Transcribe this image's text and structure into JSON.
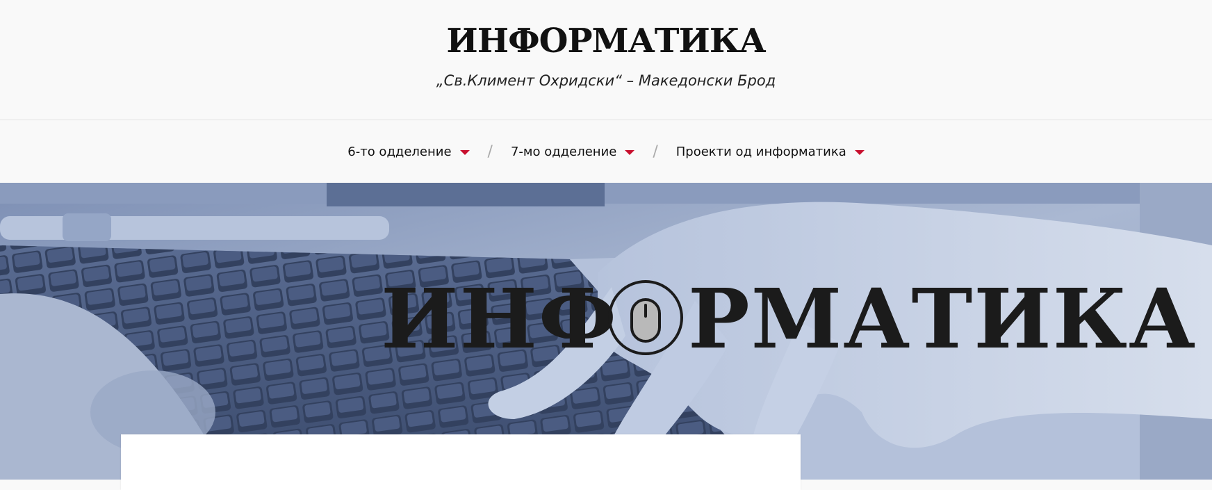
{
  "header": {
    "title": "ИНФОРМАТИКА",
    "tagline": "„Св.Климент Охридски“ – Македонски Брод"
  },
  "nav": {
    "items": [
      {
        "label": "6-то одделение",
        "icon": "caret-down-icon"
      },
      {
        "label": "7-мо одделение",
        "icon": "caret-down-icon"
      },
      {
        "label": "Проекти од информатика",
        "icon": "caret-down-icon"
      }
    ],
    "separator": "/",
    "caret_color": "#c8102e"
  },
  "hero": {
    "logo_text_left": "ИНФ",
    "logo_text_right": "РМАТИКА",
    "logo_icon": "mouse-icon",
    "image_subject": "keyboard-typing-hand",
    "tint_color": "#6f82a8"
  },
  "colors": {
    "background": "#f9f9f9",
    "text": "#111111",
    "accent": "#c8102e"
  }
}
